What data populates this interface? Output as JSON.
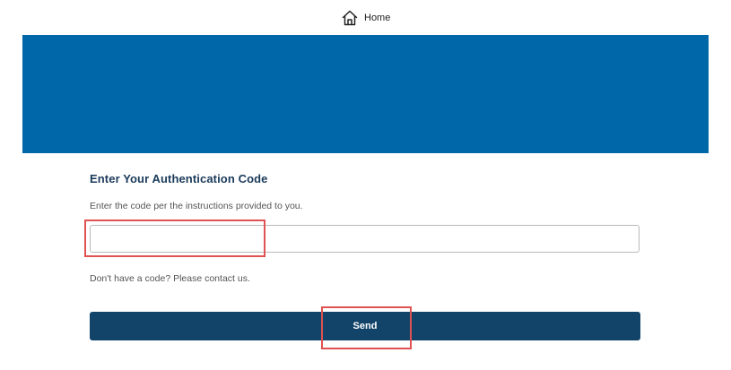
{
  "nav": {
    "home_label": "Home",
    "home_icon": "home-icon"
  },
  "banner": {
    "color": "#0067a8"
  },
  "auth": {
    "heading": "Enter Your Authentication Code",
    "instructions": "Enter the code per the instructions provided to you.",
    "code_input": {
      "value": "",
      "placeholder": ""
    },
    "contact_text": "Don't have a code? Please contact us.",
    "send_label": "Send",
    "button_color": "#12446a"
  },
  "annotations": {
    "highlight_color": "#e05252"
  }
}
